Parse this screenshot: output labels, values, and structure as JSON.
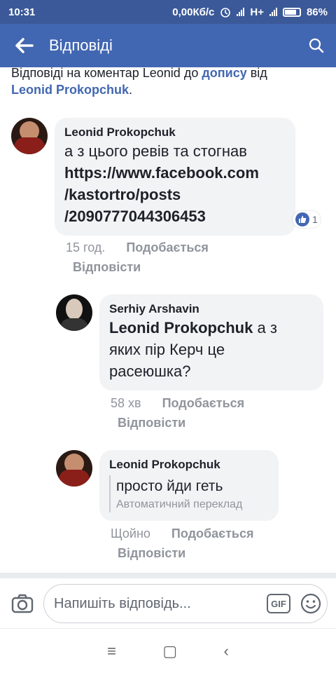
{
  "statusbar": {
    "time": "10:31",
    "net": "0,00Кб/с",
    "network_type": "H+",
    "battery": "86%"
  },
  "appbar": {
    "title": "Відповіді",
    "back_icon": "arrow-left-icon",
    "search_icon": "search-icon"
  },
  "context": {
    "prefix": "Відповіді на коментар Leonid до ",
    "post_link": "допису",
    "middle": " від ",
    "author_link": "Leonid Prokopchuk",
    "suffix": "."
  },
  "comments": [
    {
      "name": "Leonid Prokopchuk",
      "text_plain": "а з цього ревів та стогнав",
      "link_lines": [
        "https://www.facebook.com",
        "/kastortro/posts",
        "/2090777044306453"
      ],
      "likes": "1",
      "time": "15 год.",
      "like_label": "Подобається",
      "reply_label": "Відповісти"
    },
    {
      "name": "Serhiy Arshavin",
      "mention": "Leonid Prokopchuk",
      "text_lines": [
        " а з",
        "яких пір Керч це",
        "расеюшка?"
      ],
      "time": "58 хв",
      "like_label": "Подобається",
      "reply_label": "Відповісти"
    },
    {
      "name": "Leonid Prokopchuk",
      "text": "просто йди геть",
      "translation_note": "Автоматичний переклад",
      "time": "Щойно",
      "like_label": "Подобається",
      "reply_label": "Відповісти"
    }
  ],
  "composer": {
    "placeholder": "Напишіть відповідь...",
    "gif_label": "GIF"
  },
  "navbar": {
    "menu": "≡",
    "home": "▢",
    "back": "‹"
  },
  "colors": {
    "brand": "#4267b2",
    "statusbar": "#3b5998",
    "bubble": "#f2f3f5"
  }
}
